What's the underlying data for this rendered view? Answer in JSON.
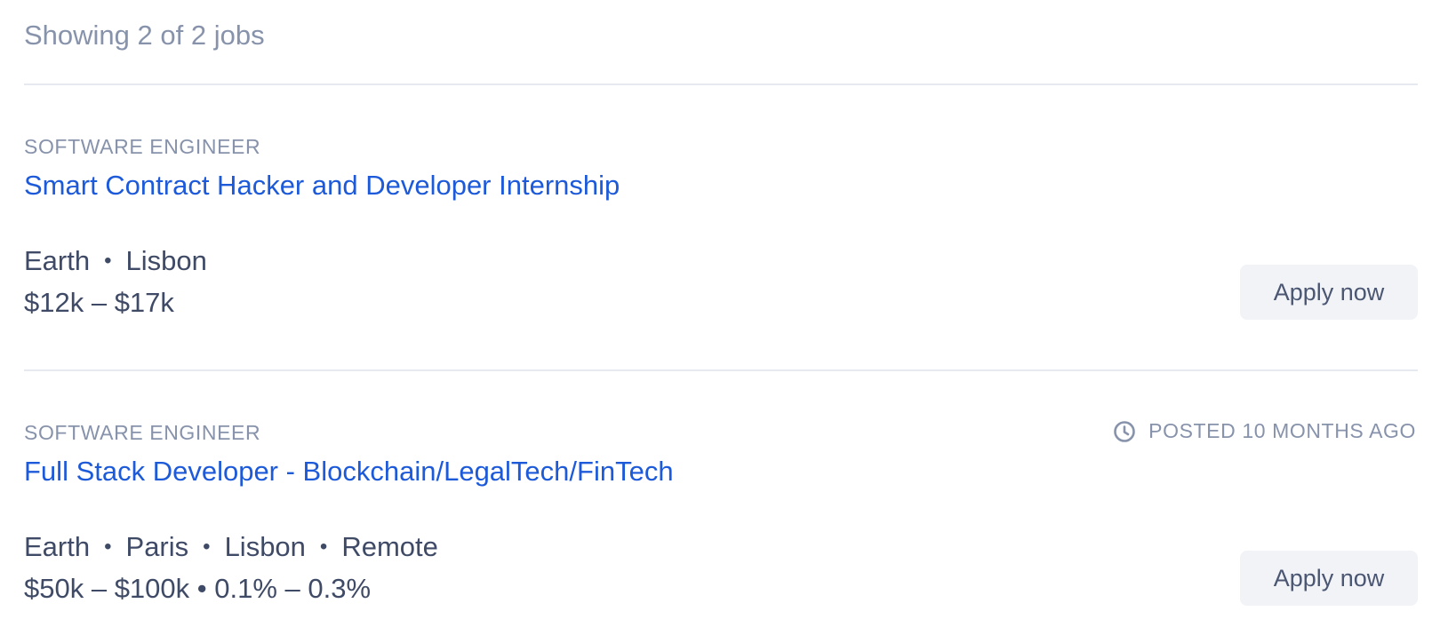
{
  "summary": "Showing 2 of 2 jobs",
  "jobs": [
    {
      "category": "SOFTWARE ENGINEER",
      "title": "Smart Contract Hacker and Developer Internship",
      "locations": [
        "Earth",
        "Lisbon"
      ],
      "compensation": "$12k – $17k",
      "apply_label": "Apply now"
    },
    {
      "category": "SOFTWARE ENGINEER",
      "posted": "POSTED 10 MONTHS AGO",
      "title": "Full Stack Developer - Blockchain/LegalTech/FinTech",
      "locations": [
        "Earth",
        "Paris",
        "Lisbon",
        "Remote"
      ],
      "compensation": "$50k – $100k • 0.1% – 0.3%",
      "apply_label": "Apply now"
    }
  ],
  "icons": {
    "posted": "clock-icon"
  },
  "colors": {
    "title_link": "#1d5ad9",
    "muted_text": "#8792ab",
    "body_text": "#3f4a66",
    "button_bg": "#f1f3f7",
    "divider": "#e6e9f0"
  },
  "separator": "•"
}
